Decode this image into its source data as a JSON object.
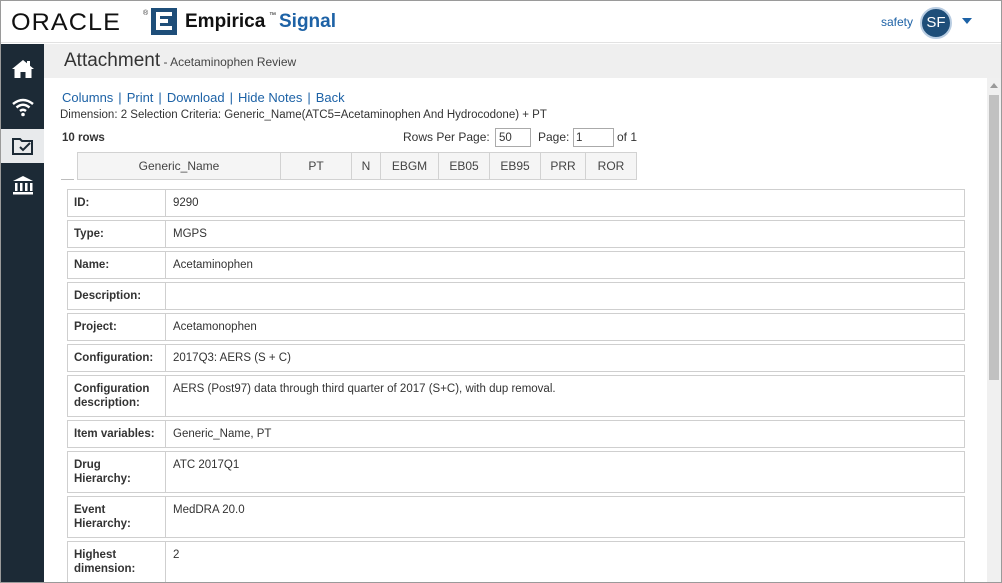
{
  "header": {
    "oracle": "ORACLE",
    "brand_empirica": "Empirica",
    "brand_tm": "™",
    "brand_signal": "Signal",
    "user_name": "safety",
    "avatar_initials": "SF"
  },
  "sidebar": {
    "items": [
      {
        "icon": "home-icon"
      },
      {
        "icon": "signal-icon"
      },
      {
        "icon": "folder-check-icon",
        "active": true
      },
      {
        "icon": "bank-icon"
      }
    ]
  },
  "title": {
    "main": "Attachment",
    "sub": " - Acetaminophen Review"
  },
  "toolbar": {
    "links": [
      "Columns",
      "Print",
      "Download",
      "Hide Notes",
      "Back"
    ]
  },
  "criteria": "Dimension: 2 Selection Criteria: Generic_Name(ATC5=Acetaminophen And Hydrocodone) + PT",
  "pagination": {
    "rows_label": "10 rows",
    "rows_per_page_label": "Rows Per Page:",
    "rows_per_page_value": "50",
    "page_label": "Page:",
    "page_value": "1",
    "of_label": "of 1"
  },
  "columns": [
    "Generic_Name",
    "PT",
    "N",
    "EBGM",
    "EB05",
    "EB95",
    "PRR",
    "ROR"
  ],
  "details": [
    {
      "label": "ID:",
      "value": "9290"
    },
    {
      "label": "Type:",
      "value": "MGPS"
    },
    {
      "label": "Name:",
      "value": "Acetaminophen"
    },
    {
      "label": "Description:",
      "value": ""
    },
    {
      "label": "Project:",
      "value": "Acetamonophen"
    },
    {
      "label": "Configuration:",
      "value": "2017Q3: AERS (S + C)"
    },
    {
      "label": "Configuration description:",
      "value": "AERS (Post97) data through third quarter of 2017 (S+C), with dup removal."
    },
    {
      "label": "Item variables:",
      "value": "Generic_Name, PT"
    },
    {
      "label": "Drug Hierarchy:",
      "value": "ATC 2017Q1"
    },
    {
      "label": "Event Hierarchy:",
      "value": "MedDRA 20.0"
    },
    {
      "label": "Highest dimension:",
      "value": "2"
    }
  ]
}
